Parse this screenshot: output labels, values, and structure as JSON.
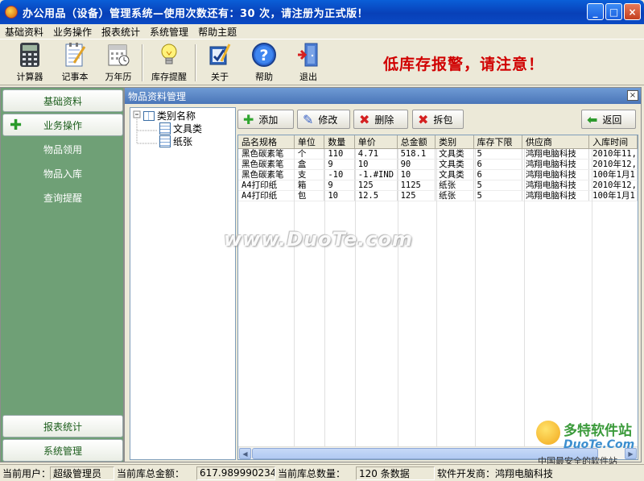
{
  "window": {
    "title": "办公用品（设备）管理系统—使用次数还有：30 次，请注册为正式版！",
    "minimize": "_",
    "maximize": "□",
    "close": "×"
  },
  "menu": [
    "基础资料",
    "业务操作",
    "报表统计",
    "系统管理",
    "帮助主题"
  ],
  "toolbar": {
    "calculator": "计算器",
    "notepad": "记事本",
    "calendar": "万年历",
    "stock_alert": "库存提醒",
    "about": "关于",
    "help": "帮助",
    "exit": "退出"
  },
  "alarm_text": "低库存报警，请注意！",
  "nav": {
    "basic": "基础资料",
    "operations": "业务操作",
    "sub_items": [
      "物品领用",
      "物品入库",
      "查询提醒"
    ],
    "reports": "报表统计",
    "system": "系统管理"
  },
  "pane": {
    "title": "物品资料管理",
    "close": "×"
  },
  "tree": {
    "root": "类别名称",
    "children": [
      "文具类",
      "纸张"
    ]
  },
  "actions": {
    "add": "添加",
    "edit": "修改",
    "delete": "删除",
    "unpack": "拆包",
    "back": "返回"
  },
  "table": {
    "columns": [
      "品名规格",
      "单位",
      "数量",
      "单价",
      "总金额",
      "类别",
      "库存下限",
      "供应商",
      "入库时间"
    ],
    "rows": [
      [
        "黑色碳素笔",
        "个",
        "110",
        "4.71",
        "518.1",
        "文具类",
        "5",
        "鸿翔电脑科技",
        "2010年11,"
      ],
      [
        "黑色碳素笔",
        "盒",
        "9",
        "10",
        "90",
        "文具类",
        "6",
        "鸿翔电脑科技",
        "2010年12,"
      ],
      [
        "黑色碳素笔",
        "支",
        "-10",
        "-1.#IND",
        "10",
        "文具类",
        "6",
        "鸿翔电脑科技",
        "100年1月1"
      ],
      [
        "A4打印纸",
        "箱",
        "9",
        "125",
        "1125",
        "纸张",
        "5",
        "鸿翔电脑科技",
        "2010年12,"
      ],
      [
        "A4打印纸",
        "包",
        "10",
        "12.5",
        "125",
        "纸张",
        "5",
        "鸿翔电脑科技",
        "100年1月1"
      ]
    ]
  },
  "watermark": "www.DuoTe.com",
  "corner_logo": {
    "line1": "多特软件站",
    "line2": "DuoTe.Com",
    "line3": "中国最安全的软件站"
  },
  "status": {
    "user_label": "当前用户：",
    "user_value": "超级管理员",
    "amount_label": "当前库总金额：",
    "amount_value": "617.9899902344",
    "qty_label": "当前库总数量：",
    "qty_value": "120 条数据",
    "dev_label": "软件开发商：鸿翔电脑科技"
  }
}
